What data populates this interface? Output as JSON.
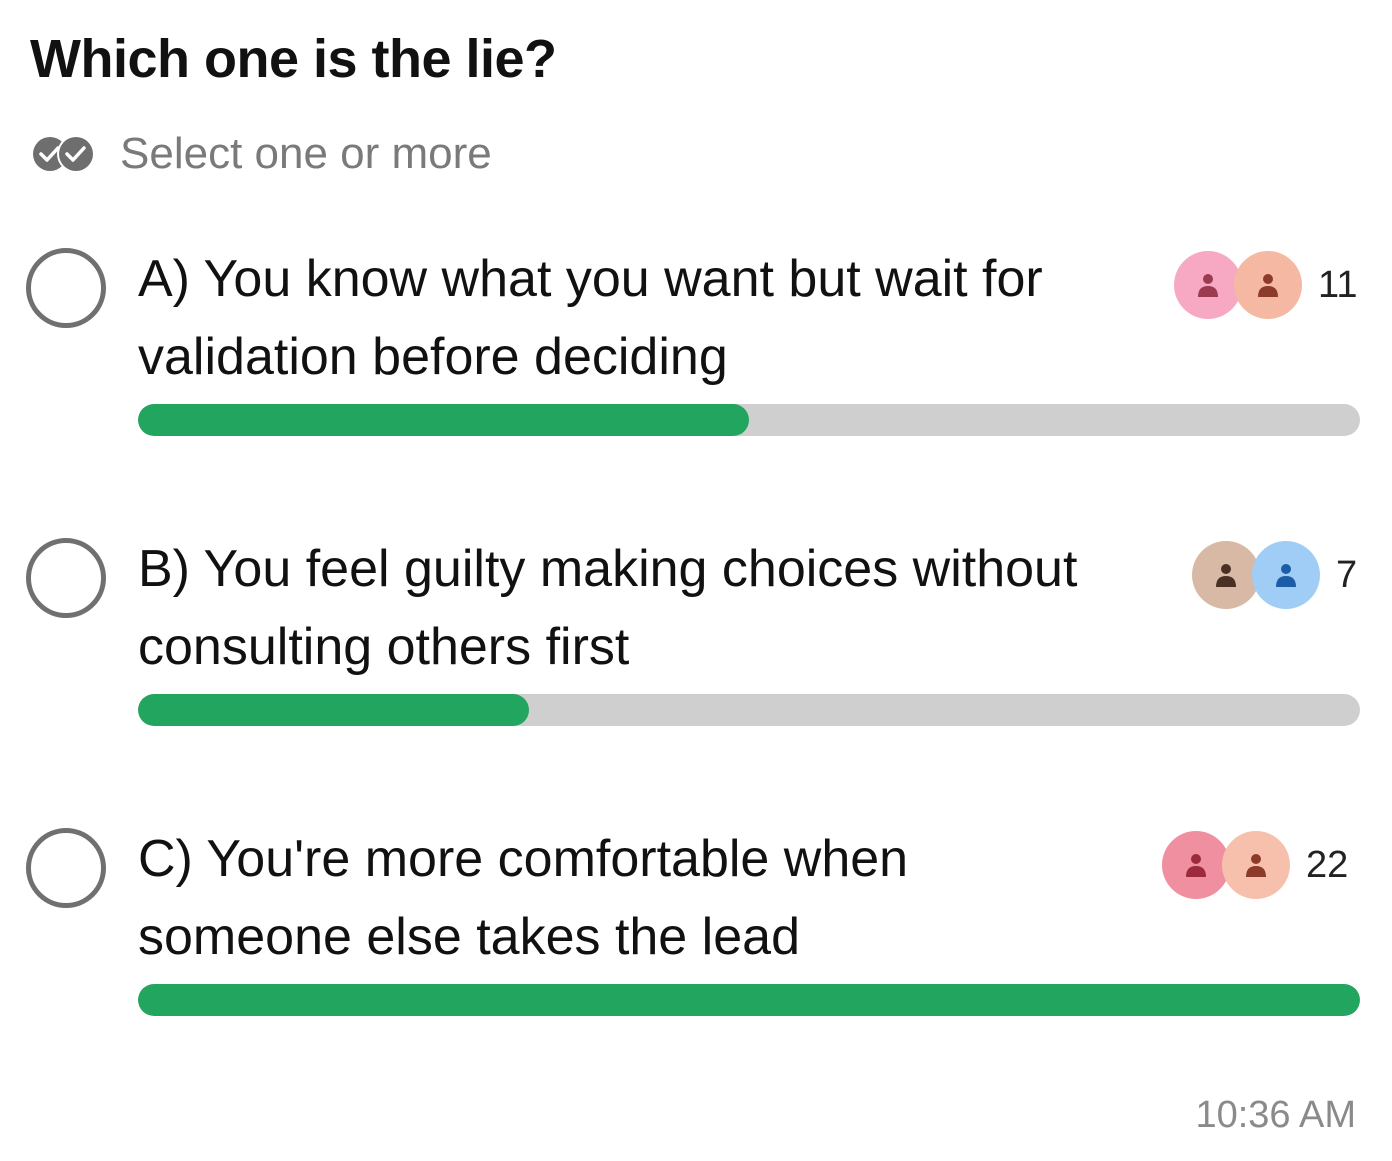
{
  "poll": {
    "title": "Which one is the lie?",
    "hint": "Select one or more",
    "options": [
      {
        "text": "A) You know what you want but wait for validation before deciding",
        "votes": "11",
        "percent": 50,
        "avatars": [
          {
            "bg": "#f7a9c4",
            "fg": "#9b3b4f"
          },
          {
            "bg": "#f5b9a3",
            "fg": "#8c3a2a"
          }
        ]
      },
      {
        "text": "B) You feel guilty making choices without consulting others first",
        "votes": "7",
        "percent": 32,
        "avatars": [
          {
            "bg": "#d8b9a6",
            "fg": "#4a3024"
          },
          {
            "bg": "#9fcdf5",
            "fg": "#1d5da8"
          }
        ]
      },
      {
        "text": "C) You're more comfortable when someone else takes the lead",
        "votes": "22",
        "percent": 100,
        "avatars": [
          {
            "bg": "#f08f9f",
            "fg": "#9b2a3d"
          },
          {
            "bg": "#f7c0ac",
            "fg": "#8c3a2a"
          }
        ]
      }
    ]
  },
  "timestamp": "10:36 AM",
  "colors": {
    "bar_fill": "#22a55e",
    "bar_track": "#cfcfcf",
    "radio_border": "#707070",
    "hint_text": "#7a7a7a"
  },
  "icons": {
    "hint": "double-check-icon",
    "avatar": "person-icon"
  }
}
